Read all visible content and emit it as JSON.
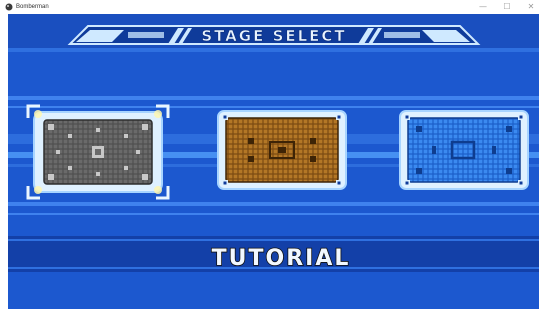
{
  "window": {
    "title": "Bomberman",
    "controls": {
      "minimize": "—",
      "maximize": "☐",
      "close": "✕"
    }
  },
  "screen": {
    "header": "STAGE SELECT",
    "selected_stage_name": "TUTORIAL"
  },
  "stages": [
    {
      "name": "TUTORIAL",
      "theme": "gray",
      "selected": true
    },
    {
      "name": "",
      "theme": "brown",
      "selected": false
    },
    {
      "name": "",
      "theme": "blue",
      "selected": false
    }
  ],
  "colors": {
    "background": "#1c58cf",
    "band_light": "#3f82ee",
    "band_dark": "#1340a8",
    "frame": "#dff1ff",
    "frame_shadow": "#2a7fd9",
    "gray_tile": "#5a5a5a",
    "brown_tile": "#a56d22",
    "blue_tile": "#2a7be6",
    "title_text": "#e9f4ff",
    "selection": "#fff7b0"
  }
}
